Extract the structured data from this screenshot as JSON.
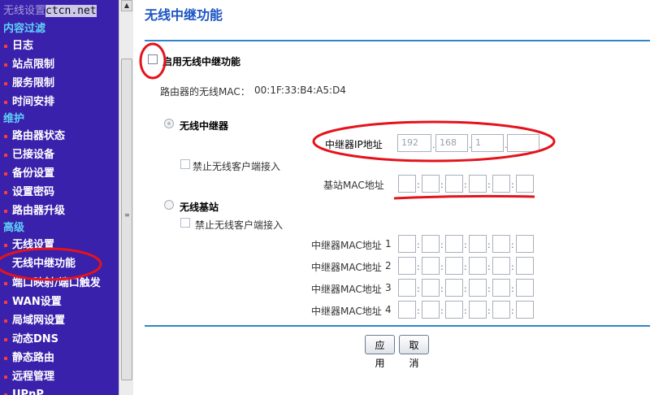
{
  "watermark": {
    "text": "ctcn.net",
    "obscured_label": "无线设置"
  },
  "sidebar": {
    "sections": [
      {
        "label": "内容过滤"
      },
      {
        "label": "维护"
      },
      {
        "label": "高级"
      }
    ],
    "items": [
      {
        "label": "日志"
      },
      {
        "label": "站点限制"
      },
      {
        "label": "服务限制"
      },
      {
        "label": "时间安排"
      },
      {
        "label": "路由器状态"
      },
      {
        "label": "已接设备"
      },
      {
        "label": "备份设置"
      },
      {
        "label": "设置密码"
      },
      {
        "label": "路由器升级"
      },
      {
        "label": "无线设置"
      },
      {
        "label": "无线中继功能"
      },
      {
        "label": "端口映射/端口触发"
      },
      {
        "label": "WAN设置"
      },
      {
        "label": "局域网设置"
      },
      {
        "label": "动态DNS"
      },
      {
        "label": "静态路由"
      },
      {
        "label": "远程管理"
      },
      {
        "label": "UPnP"
      }
    ]
  },
  "main": {
    "title": "无线中继功能",
    "enable_label": "启用无线中继功能",
    "mac_label": "路由器的无线MAC：",
    "mac_value": "00:1F:33:B4:A5:D4",
    "repeater": {
      "label": "无线中继器",
      "ip_label": "中继器IP地址",
      "ip": [
        "192",
        "168",
        "1",
        ""
      ],
      "disable_clients_label": "禁止无线客户端接入",
      "base_mac_label": "基站MAC地址"
    },
    "base_station": {
      "label": "无线基站",
      "disable_clients_label": "禁止无线客户端接入",
      "repeater_mac_label": "中继器MAC地址",
      "rows": [
        "1",
        "2",
        "3",
        "4"
      ]
    },
    "buttons": {
      "apply": "应用",
      "cancel": "取消"
    }
  },
  "annotation_color": "#e4131c"
}
